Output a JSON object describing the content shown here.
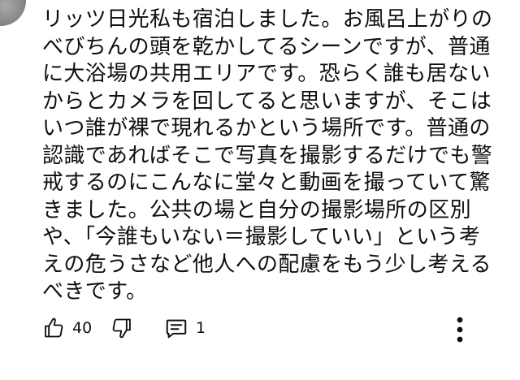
{
  "comment": {
    "lines": [
      "リッツ日光私も宿泊しました。お風呂上がりの",
      "べびちんの頭を乾かしてるシーンですが、普通",
      "に大浴場の共用エリアです。恐らく誰も居ない",
      "からとカメラを回してると思いますが、そこは",
      "いつ誰が裸で現れるかという場所です。普通の",
      "認識であればそこで写真を撮影するだけでも警",
      "戒するのにこんなに堂々と動画を撮っていて驚",
      "きました。公共の場と自分の撮影場所の区別",
      "や、「今誰もいない＝撮影していい」という考",
      "えの危うさなど他人への配慮をもう少し考える",
      "べきです。"
    ]
  },
  "actions": {
    "like_count": "40",
    "reply_count": "1",
    "icons": {
      "like": "thumbs-up-icon",
      "dislike": "thumbs-down-icon",
      "reply": "comment-icon",
      "menu": "more-vertical-icon"
    }
  }
}
